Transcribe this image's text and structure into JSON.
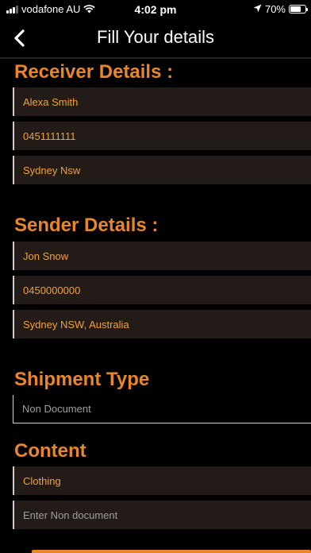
{
  "status_bar": {
    "carrier": "vodafone AU",
    "time": "4:02 pm",
    "battery": "70%",
    "battery_level": 0.7
  },
  "nav": {
    "title": "Fill Your details",
    "back_icon": "chevron-left-icon"
  },
  "receiver": {
    "title": "Receiver Details :",
    "name": "Alexa Smith",
    "phone": "0451111111",
    "address": "Sydney Nsw"
  },
  "sender": {
    "title": "Sender Details :",
    "name": "Jon Snow",
    "phone": "0450000000",
    "address": "Sydney NSW, Australia"
  },
  "shipment": {
    "title": "Shipment Type",
    "placeholder": "Non Document"
  },
  "content": {
    "title": "Content",
    "value": "Clothing",
    "placeholder": "Enter Non document"
  },
  "colors": {
    "accent": "#e8862c",
    "field_bg": "#231b17",
    "value_text": "#f0a23a"
  }
}
